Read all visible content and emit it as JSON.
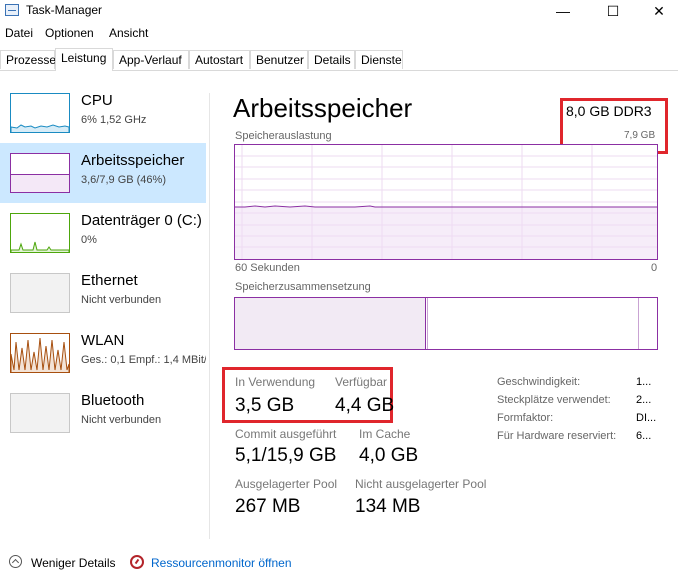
{
  "window": {
    "title": "Task-Manager",
    "minimize_glyph": "—",
    "maximize_glyph": "☐",
    "close_glyph": "✕"
  },
  "menu": {
    "items": [
      "Datei",
      "Optionen",
      "Ansicht"
    ]
  },
  "tabs": [
    "Prozesse",
    "Leistung",
    "App-Verlauf",
    "Autostart",
    "Benutzer",
    "Details",
    "Dienste"
  ],
  "active_tab": "Leistung",
  "sidebar": {
    "items": [
      {
        "name": "CPU",
        "sub": "6%  1,52 GHz",
        "color": "#1a8bc2"
      },
      {
        "name": "Arbeitsspeicher",
        "sub": "3,6/7,9 GB (46%)",
        "color": "#8b2fa3"
      },
      {
        "name": "Datenträger 0 (C:)",
        "sub": "0%",
        "color": "#4da60c"
      },
      {
        "name": "Ethernet",
        "sub": "Nicht verbunden",
        "color": "#b5b5b5"
      },
      {
        "name": "WLAN",
        "sub": "Ges.: 0,1  Empf.: 1,4 MBit/s",
        "color": "#a74f0f"
      },
      {
        "name": "Bluetooth",
        "sub": "Nicht verbunden",
        "color": "#b5b5b5"
      }
    ]
  },
  "main": {
    "title": "Arbeitsspeicher",
    "ram_type": "8,0 GB DDR3",
    "ram_total": "7,9 GB",
    "usage_label": "Speicherauslastung",
    "axis_left": "60 Sekunden",
    "axis_right": "0",
    "composition_label": "Speicherzusammensetzung",
    "usage_percent": 46,
    "accent_color": "#8b2fa3"
  },
  "stats": {
    "in_use_label": "In Verwendung",
    "in_use_value": "3,5 GB",
    "available_label": "Verfügbar",
    "available_value": "4,4 GB",
    "commit_label": "Commit ausgeführt",
    "commit_value": "5,1/15,9 GB",
    "cache_label": "Im Cache",
    "cache_value": "4,0 GB",
    "paged_label": "Ausgelagerter Pool",
    "paged_value": "267 MB",
    "nonpaged_label": "Nicht ausgelagerter Pool",
    "nonpaged_value": "134 MB"
  },
  "properties": [
    {
      "label": "Geschwindigkeit:",
      "value": "1..."
    },
    {
      "label": "Steckplätze verwendet:",
      "value": "2..."
    },
    {
      "label": "Formfaktor:",
      "value": "DI..."
    },
    {
      "label": "Für Hardware reserviert:",
      "value": "6..."
    }
  ],
  "footer": {
    "fewer_details": "Weniger Details",
    "resource_monitor": "Ressourcenmonitor öffnen"
  }
}
